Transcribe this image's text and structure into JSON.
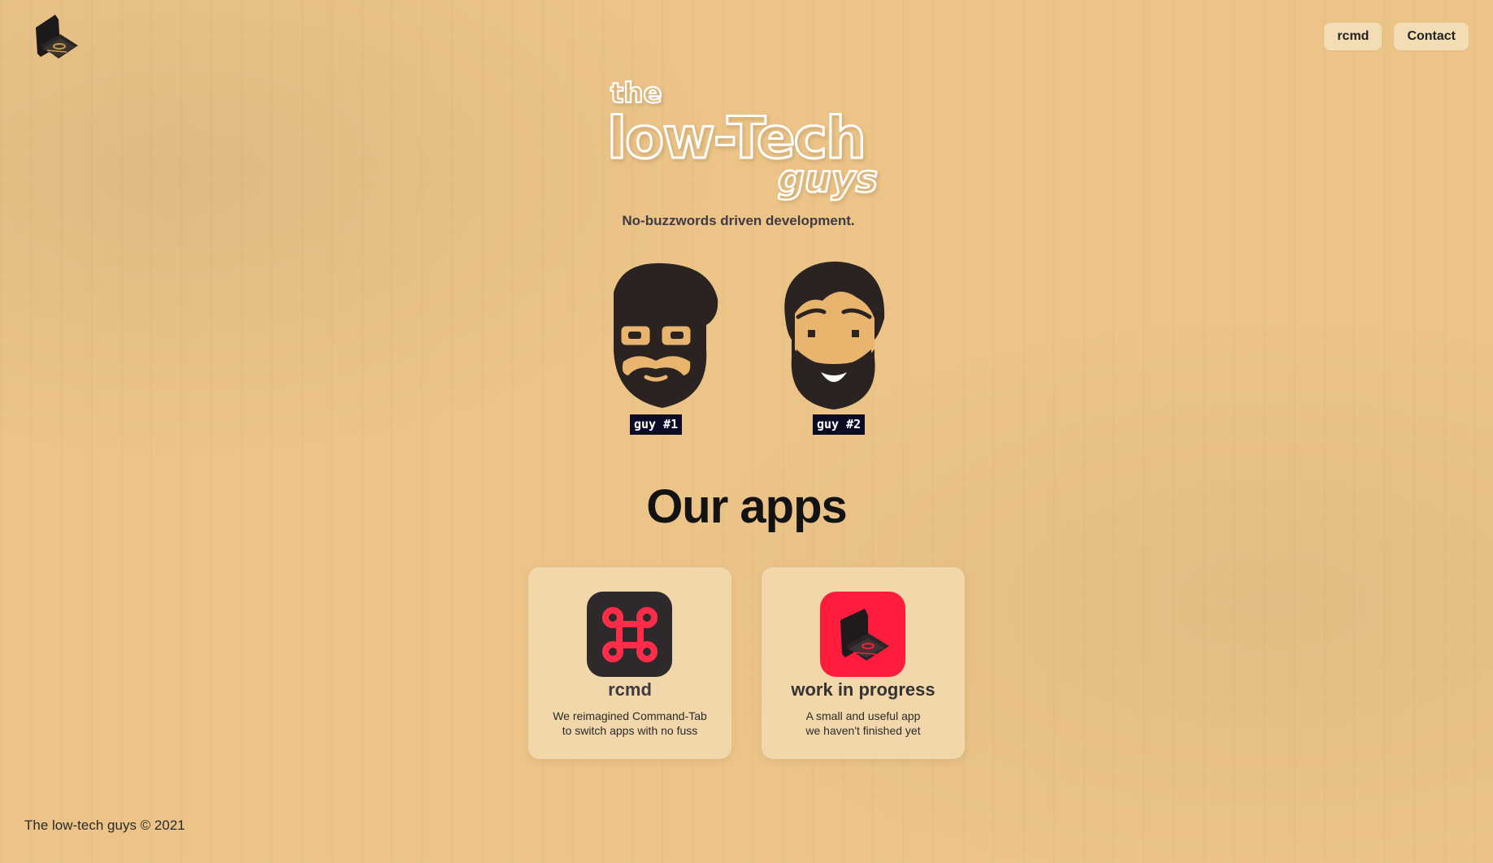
{
  "header": {
    "logo_icon": "typewriter-icon",
    "nav": [
      {
        "label": "rcmd"
      },
      {
        "label": "Contact"
      }
    ]
  },
  "hero": {
    "wordmark": {
      "line1": "the",
      "line2": "low-Tech",
      "line3": "guys"
    },
    "tagline": "No-buzzwords driven development.",
    "guys": [
      {
        "label": "guy #1",
        "icon": "bearded-glasses-face-icon"
      },
      {
        "label": "guy #2",
        "icon": "bearded-face-icon"
      }
    ]
  },
  "apps": {
    "title": "Our apps",
    "items": [
      {
        "name": "rcmd",
        "desc_line1": "We reimagined Command-Tab",
        "desc_line2": "to switch apps with no fuss",
        "icon": "command-key-icon",
        "icon_bg": "#2e2a2c",
        "icon_glyph": "⌘"
      },
      {
        "name": "work in progress",
        "desc_line1": "A small and useful app",
        "desc_line2": "we haven't finished yet",
        "icon": "typewriter-icon",
        "icon_bg": "#ff1c3d"
      }
    ]
  },
  "footer": {
    "text": "The low-tech guys © 2021"
  },
  "colors": {
    "background": "#ecc488",
    "card": "#f1d7aa",
    "label_bg": "#0b0b26",
    "accent_red": "#ff1c3d"
  }
}
